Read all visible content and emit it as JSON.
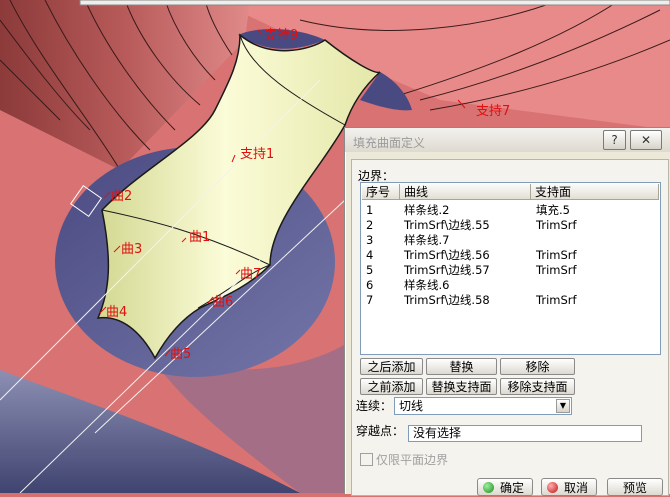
{
  "viewport": {
    "labels": {
      "support9": "支持9",
      "support7": "支持7",
      "support1": "支持1",
      "curve2": "曲2",
      "curve3": "曲3",
      "curve1": "曲1",
      "curve7": "曲7",
      "curve6": "曲6",
      "curve4": "曲4",
      "curve5": "曲5"
    }
  },
  "dialog": {
    "title": "填充曲面定义",
    "help_glyph": "?",
    "close_glyph": "✕",
    "boundary_label": "边界：",
    "table": {
      "headers": [
        "序号",
        "曲线",
        "支持面"
      ],
      "rows": [
        [
          "1",
          "样条线.2",
          "填充.5"
        ],
        [
          "2",
          "TrimSrf\\边线.55",
          "TrimSrf"
        ],
        [
          "3",
          "样条线.7",
          ""
        ],
        [
          "4",
          "TrimSrf\\边线.56",
          "TrimSrf"
        ],
        [
          "5",
          "TrimSrf\\边线.57",
          "TrimSrf"
        ],
        [
          "6",
          "样条线.6",
          ""
        ],
        [
          "7",
          "TrimSrf\\边线.58",
          "TrimSrf"
        ]
      ]
    },
    "buttons": {
      "add_after": "之后添加",
      "replace": "替换",
      "remove": "移除",
      "add_before": "之前添加",
      "replace_support": "替换支持面",
      "remove_support": "移除支持面"
    },
    "continuity_label": "连续：",
    "continuity_value": "切线",
    "pass_point_label": "穿越点：",
    "pass_point_value": "没有选择",
    "planar_only_label": "仅限平面边界",
    "ok_label": "确定",
    "cancel_label": "取消",
    "preview_label": "预览"
  }
}
